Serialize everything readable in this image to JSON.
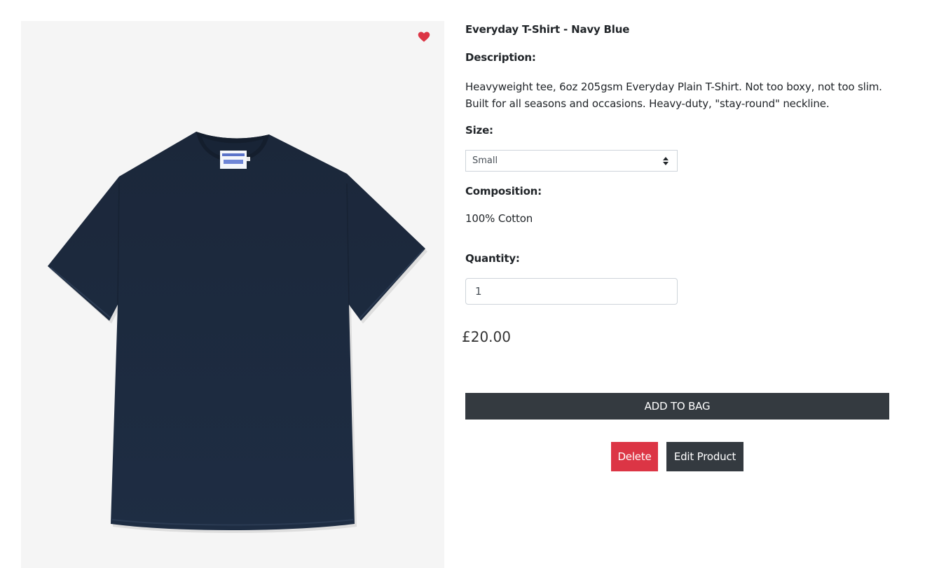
{
  "product": {
    "title": "Everyday T-Shirt - Navy Blue",
    "description_label": "Description:",
    "description": "Heavyweight tee, 6oz 205gsm Everyday Plain T-Shirt. Not too boxy, not too slim. Built for all seasons and occasions. Heavy-duty, \"stay-round\" neckline.",
    "size_label": "Size:",
    "size_selected": "Small",
    "composition_label": "Composition:",
    "composition": "100% Cotton",
    "quantity_label": "Quantity:",
    "quantity": "1",
    "price": "£20.00"
  },
  "actions": {
    "add_to_bag": "ADD TO BAG",
    "delete": "Delete",
    "edit": "Edit Product"
  },
  "icons": {
    "wishlist": "heart-icon",
    "select_caret": "sort-caret-icon"
  },
  "colors": {
    "heart": "#dc3545",
    "dark_button": "#343a40",
    "delete_button": "#dc3545",
    "image_background": "#f5f5f5",
    "shirt": "#1c2a3e"
  }
}
